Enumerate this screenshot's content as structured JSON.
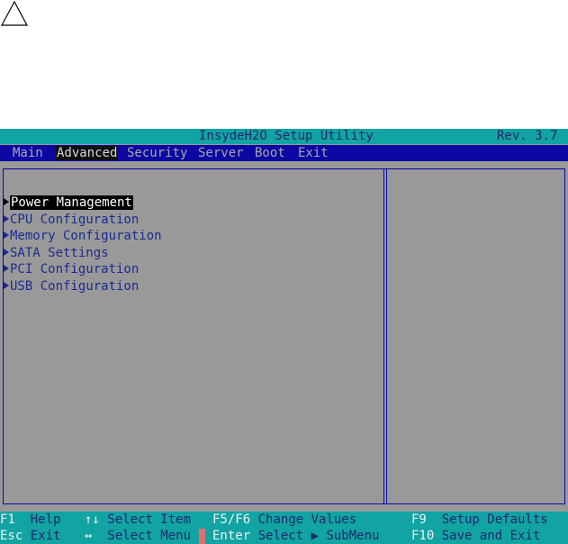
{
  "warning_icon": "warning-triangle-icon",
  "bios": {
    "title": "InsydeH2O Setup Utility",
    "revision": "Rev. 3.7",
    "tabs": [
      {
        "label": "Main",
        "active": false
      },
      {
        "label": "Advanced",
        "active": true
      },
      {
        "label": "Security",
        "active": false
      },
      {
        "label": "Server",
        "active": false
      },
      {
        "label": "Boot",
        "active": false
      },
      {
        "label": "Exit",
        "active": false
      }
    ],
    "menu_items": [
      {
        "label": "Power Management",
        "selected": true
      },
      {
        "label": "CPU Configuration",
        "selected": false
      },
      {
        "label": "Memory Configuration",
        "selected": false
      },
      {
        "label": "SATA Settings",
        "selected": false
      },
      {
        "label": "PCI Configuration",
        "selected": false
      },
      {
        "label": "USB Configuration",
        "selected": false
      }
    ],
    "footer": {
      "row1": [
        {
          "key": "F1",
          "desc": "Help"
        },
        {
          "key": "↑↓",
          "desc": "Select Item"
        },
        {
          "key": "F5/F6",
          "desc": "Change Values"
        },
        {
          "key": "F9",
          "desc": "Setup Defaults"
        }
      ],
      "row2": [
        {
          "key": "Esc",
          "desc": "Exit"
        },
        {
          "key": "↔",
          "desc": "Select Menu"
        },
        {
          "key": "Enter",
          "desc": "Select ▶ SubMenu"
        },
        {
          "key": "F10",
          "desc": "Save and Exit"
        }
      ]
    },
    "colors": {
      "title_bar": "#12a3a3",
      "menu_bar": "#0c07a3",
      "panel_bg": "#999999",
      "item_text": "#1d2a8e"
    }
  }
}
